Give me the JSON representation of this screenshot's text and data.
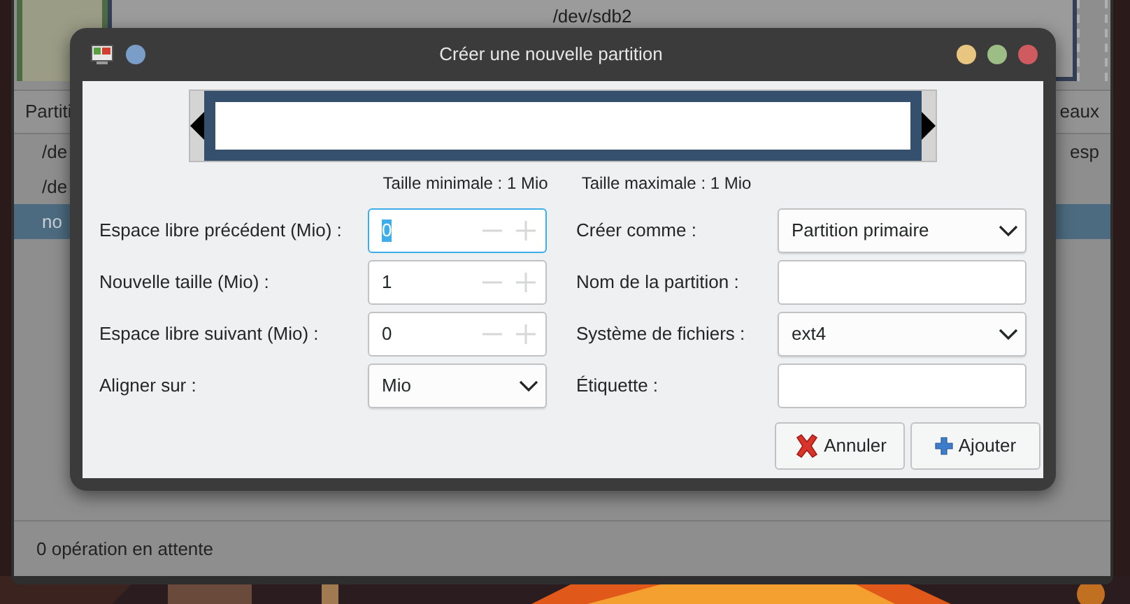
{
  "background_window": {
    "disk_label": "/dev/sdb2",
    "columns": [
      "Partiti",
      "eaux"
    ],
    "rows": [
      {
        "column_1": "/de",
        "column_2": "esp",
        "selected": false
      },
      {
        "column_1": "/de",
        "selected": false
      },
      {
        "column_1": "no",
        "selected": true
      }
    ],
    "status_bar": "0 opération en attente"
  },
  "dialog": {
    "title": "Créer une nouvelle partition",
    "size_labels": [
      "Taille minimale : 1 Mio",
      "Taille maximale : 1 Mio"
    ],
    "left_fields": [
      {
        "kind": "spin",
        "label": "Espace libre précédent (Mio) :",
        "value": "0",
        "focused": true
      },
      {
        "kind": "spin",
        "label": "Nouvelle taille (Mio) :",
        "value": "1",
        "focused": false
      },
      {
        "kind": "spin",
        "label": "Espace libre suivant (Mio) :",
        "value": "0",
        "focused": false
      },
      {
        "kind": "select",
        "label": "Aligner sur :",
        "value": "Mio",
        "focused": false
      }
    ],
    "right_fields": [
      {
        "kind": "select",
        "label": "Créer comme :",
        "value": "Partition primaire",
        "focused": false
      },
      {
        "kind": "text",
        "label": "Nom de la partition :",
        "focused": false
      },
      {
        "kind": "select",
        "label": "Système de fichiers :",
        "value": "ext4",
        "focused": false
      },
      {
        "kind": "text",
        "label": "Étiquette :",
        "focused": false
      }
    ],
    "buttons": [
      {
        "kind": "cancel",
        "label": "Annuler"
      },
      {
        "kind": "add",
        "label": "Ajouter"
      }
    ]
  }
}
